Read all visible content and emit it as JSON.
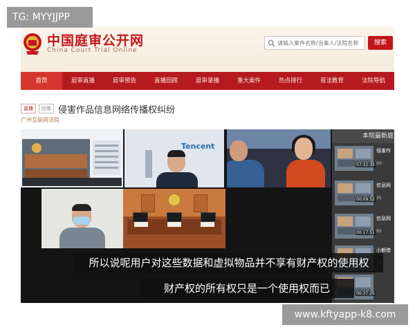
{
  "watermark": {
    "top": "TG: MYYJJPP",
    "bottom": "www.kftyapp-k8.com"
  },
  "header": {
    "site_title": "中国庭审公开网",
    "site_subtitle": "China Court Trial Online",
    "search_placeholder": "请输入案件名称/当事人/法院名称",
    "search_button": "搜索"
  },
  "nav": {
    "items": [
      "首页",
      "庭审直播",
      "庭审预告",
      "直播回顾",
      "庭审录播",
      "重大案件",
      "热点排行",
      "普法教育",
      "法院导航"
    ],
    "active_index": 0
  },
  "case": {
    "tags": [
      "直播",
      "回看"
    ],
    "title": "侵害作品信息网络传播权纠纷",
    "court": "广州互联网法院"
  },
  "video": {
    "presenter_brand": "Tencent",
    "subtitles": [
      "所以说呢用户对这些数据和虚拟物品并不享有财产权的使用权",
      "财产权的所有权只是一个使用权而已"
    ]
  },
  "sidebar": {
    "title": "本院最新庭",
    "items": [
      {
        "name": "侵害作",
        "duration": "07:32:35",
        "views": "50"
      },
      {
        "name": "信息网",
        "duration": "00:09:52",
        "views": "35"
      },
      {
        "name": "信息网",
        "duration": "00:17:51",
        "views": "95"
      },
      {
        "name": "小额借",
        "duration": "",
        "views": "19"
      },
      {
        "name": "",
        "duration": "00:37:25",
        "views": ""
      }
    ]
  },
  "colors": {
    "brand_red": "#c4161c",
    "nav_bg": "#b51a20",
    "nav_active": "#d4362d"
  }
}
